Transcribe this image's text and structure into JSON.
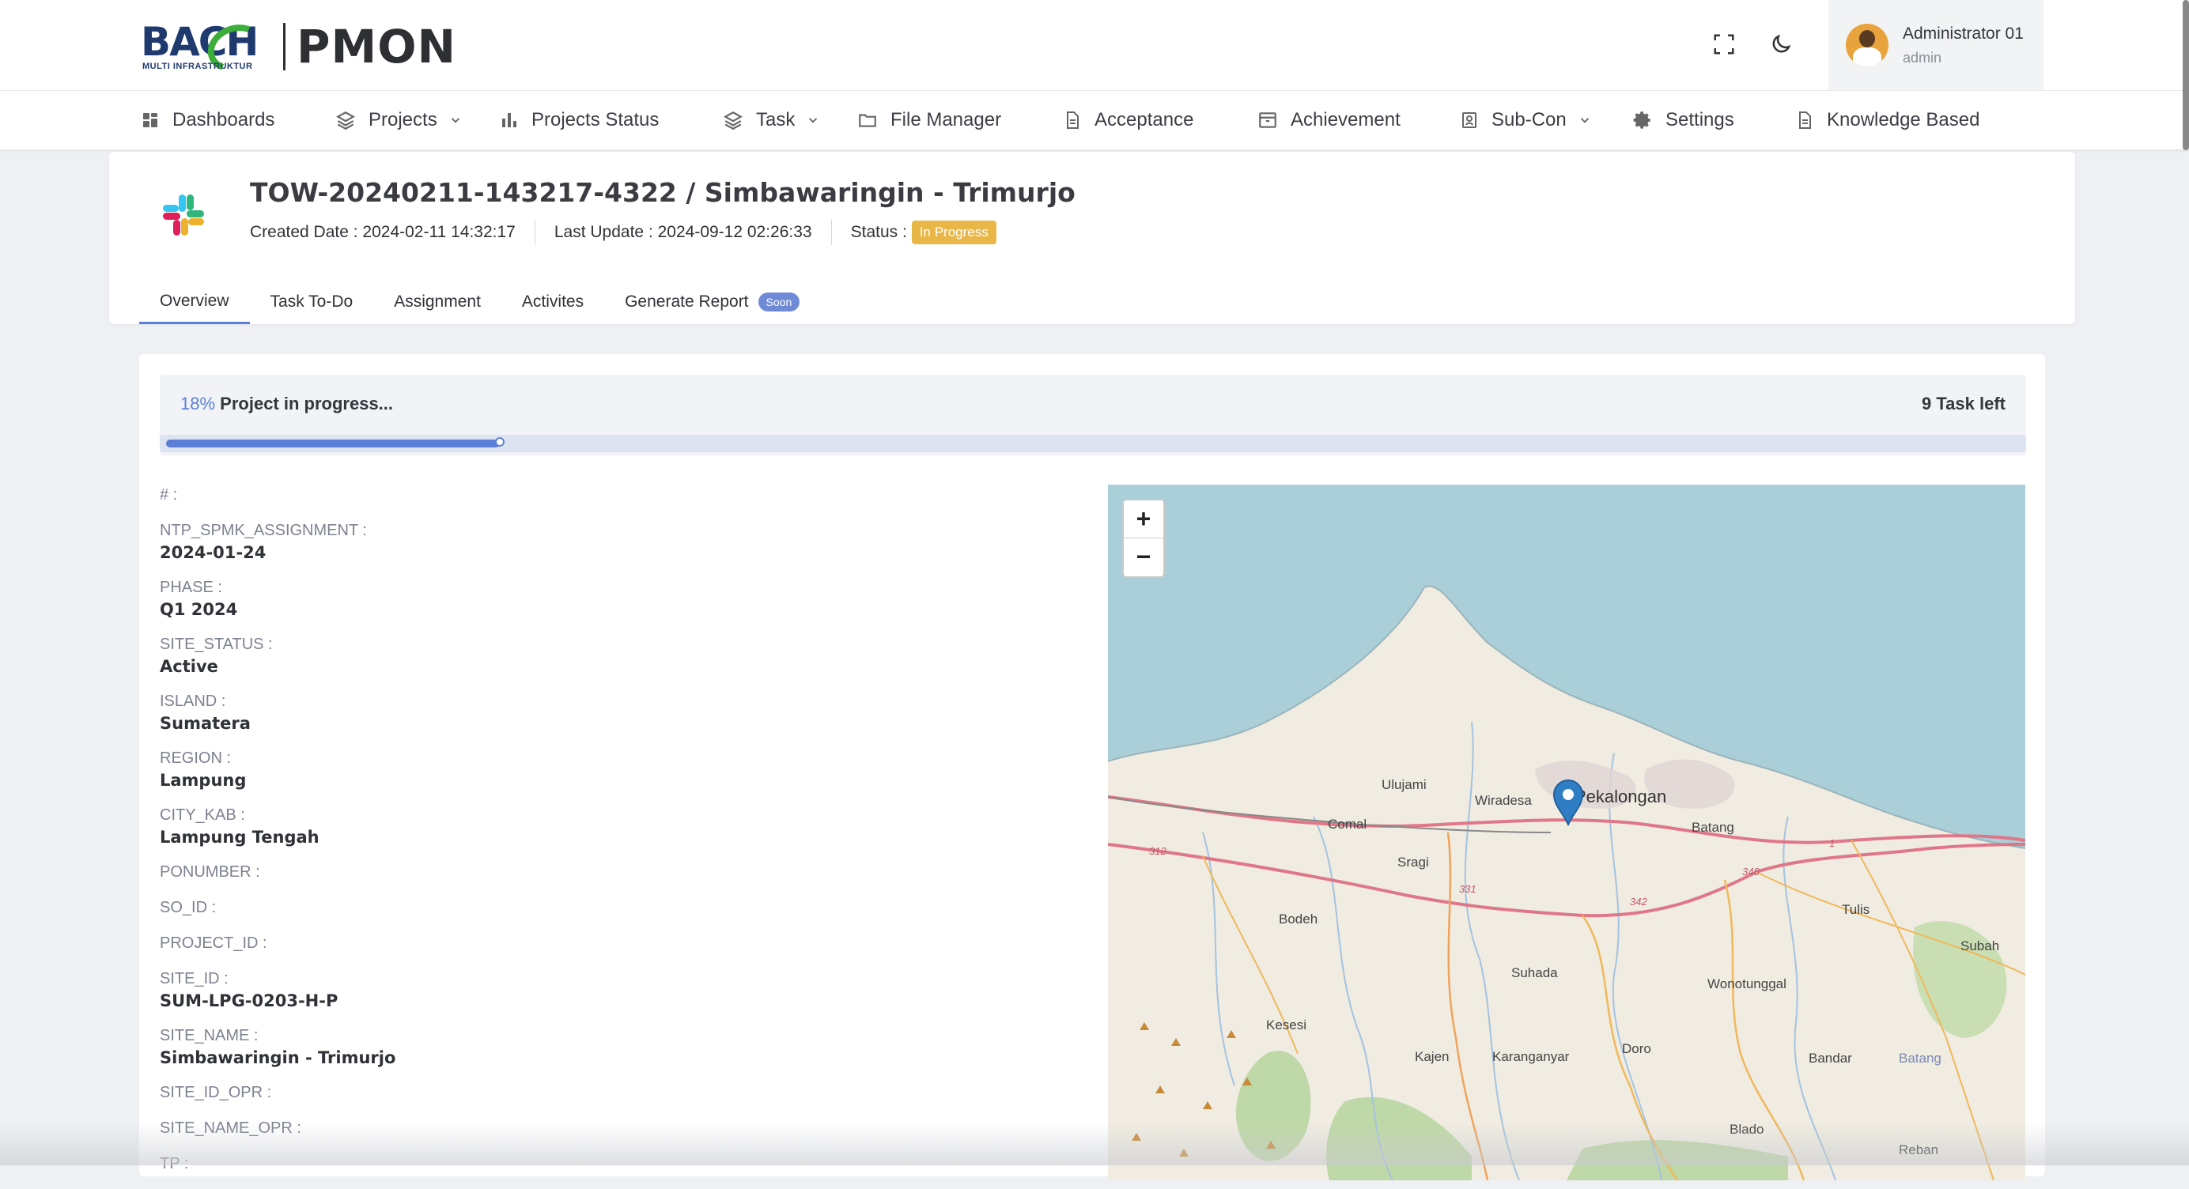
{
  "brand": {
    "logo_word": "BACH",
    "logo_sub": "MULTI INFRASTRUKTUR",
    "app_name": "PMON"
  },
  "header": {
    "user_name": "Administrator 01",
    "user_role": "admin"
  },
  "nav": [
    {
      "label": "Dashboards",
      "icon": "grid-icon"
    },
    {
      "label": "Projects",
      "icon": "layers-icon",
      "dropdown": true
    },
    {
      "label": "Projects Status",
      "icon": "bar-chart-icon"
    },
    {
      "label": "Task",
      "icon": "layers-icon",
      "dropdown": true
    },
    {
      "label": "File Manager",
      "icon": "folder-icon"
    },
    {
      "label": "Acceptance",
      "icon": "document-icon"
    },
    {
      "label": "Achievement",
      "icon": "archive-icon"
    },
    {
      "label": "Sub-Con",
      "icon": "badge-icon",
      "dropdown": true
    },
    {
      "label": "Settings",
      "icon": "gear-icon"
    },
    {
      "label": "Knowledge Based",
      "icon": "document-icon"
    }
  ],
  "project": {
    "title": "TOW-20240211-143217-4322 / Simbawaringin - Trimurjo",
    "created": "Created Date : 2024-02-11 14:32:17",
    "updated": "Last Update : 2024-09-12 02:26:33",
    "status_label": "Status :",
    "status": "In Progress"
  },
  "tabs": [
    {
      "label": "Overview",
      "active": true
    },
    {
      "label": "Task To-Do"
    },
    {
      "label": "Assignment"
    },
    {
      "label": "Activites"
    },
    {
      "label": "Generate Report",
      "badge": "Soon"
    }
  ],
  "progress": {
    "percent_text": "18%",
    "label": "Project in progress...",
    "tasks_left": "9 Task left",
    "fraction": 0.18
  },
  "fields": [
    {
      "label": "# :",
      "value": ""
    },
    {
      "label": "NTP_SPMK_ASSIGNMENT :",
      "value": "2024-01-24"
    },
    {
      "label": "PHASE :",
      "value": "Q1 2024"
    },
    {
      "label": "SITE_STATUS :",
      "value": "Active"
    },
    {
      "label": "ISLAND :",
      "value": "Sumatera"
    },
    {
      "label": "REGION :",
      "value": "Lampung"
    },
    {
      "label": "CITY_KAB :",
      "value": "Lampung Tengah"
    },
    {
      "label": "PONUMBER :",
      "value": ""
    },
    {
      "label": "SO_ID :",
      "value": ""
    },
    {
      "label": "PROJECT_ID :",
      "value": ""
    },
    {
      "label": "SITE_ID :",
      "value": "SUM-LPG-0203-H-P"
    },
    {
      "label": "SITE_NAME :",
      "value": "Simbawaringin - Trimurjo"
    },
    {
      "label": "SITE_ID_OPR :",
      "value": ""
    },
    {
      "label": "SITE_NAME_OPR :",
      "value": ""
    },
    {
      "label": "TP :",
      "value": ""
    }
  ],
  "map": {
    "zoom_in": "+",
    "zoom_out": "−",
    "towns": [
      "Ulujami",
      "Wiradesa",
      "Pekalongan",
      "Comal",
      "Batang",
      "Sragi",
      "Bodeh",
      "Tulis",
      "Subah",
      "Suhada",
      "Wonotunggal",
      "Kesesi",
      "Doro",
      "Kajen",
      "Karanganyar",
      "Bandar",
      "Batang",
      "Blado",
      "Reban"
    ],
    "road_numbers": [
      "312",
      "331",
      "342",
      "348",
      "1"
    ],
    "water_color": "#aacfd8",
    "land_color": "#f0ece2",
    "marker_color": "#2f7ec4"
  },
  "colors": {
    "accent": "#5b7fd6",
    "status_badge": "#e8b748",
    "brand_green": "#3dae3a",
    "brand_navy": "#1f3a6e"
  }
}
